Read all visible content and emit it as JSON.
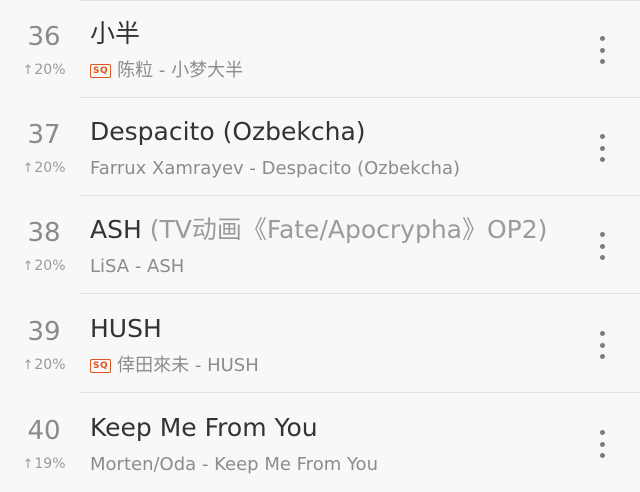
{
  "songs": [
    {
      "rank": "36",
      "change": "20%",
      "title": "小半",
      "alias": "",
      "sq": true,
      "subtitle": "陈粒 - 小梦大半"
    },
    {
      "rank": "37",
      "change": "20%",
      "title": "Despacito (Ozbekcha)",
      "alias": "",
      "sq": false,
      "subtitle": "Farrux Xamrayev - Despacito (Ozbekcha)"
    },
    {
      "rank": "38",
      "change": "20%",
      "title": "ASH",
      "alias": " (TV动画《Fate/Apocrypha》OP2)",
      "sq": false,
      "subtitle": "LiSA - ASH"
    },
    {
      "rank": "39",
      "change": "20%",
      "title": "HUSH",
      "alias": "",
      "sq": true,
      "subtitle": "倖田來未 - HUSH"
    },
    {
      "rank": "40",
      "change": "19%",
      "title": "Keep Me From You",
      "alias": "",
      "sq": false,
      "subtitle": "Morten/Oda - Keep Me From You"
    }
  ],
  "icons": {
    "change_arrow": "↑",
    "sq_label": "SQ",
    "more": "more-vertical-icon"
  },
  "colors": {
    "background": "#f8f8f8",
    "sq_badge": "#e0541e",
    "title": "#333333",
    "secondary": "#8c8c8c"
  }
}
